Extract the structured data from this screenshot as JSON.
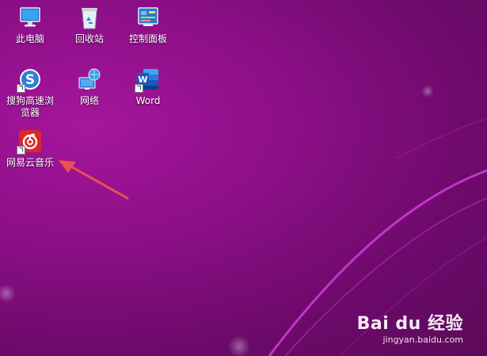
{
  "desktop": {
    "icons": [
      {
        "label": "此电脑",
        "icon": "computer-icon"
      },
      {
        "label": "回收站",
        "icon": "recycle-bin-icon"
      },
      {
        "label": "控制面板",
        "icon": "control-panel-icon"
      },
      {
        "label": "搜狗高速浏览器",
        "icon": "sogou-browser-icon"
      },
      {
        "label": "网络",
        "icon": "network-icon"
      },
      {
        "label": "Word",
        "icon": "word-icon"
      },
      {
        "label": "网易云音乐",
        "icon": "netease-music-icon"
      }
    ]
  },
  "annotation": {
    "arrow_color": "#e8524f"
  },
  "watermark": {
    "brand": "Bai du 经验",
    "url": "jingyan.baidu.com"
  },
  "colors": {
    "background": "#8d0f88",
    "accent_curve": "#c42ccf"
  }
}
